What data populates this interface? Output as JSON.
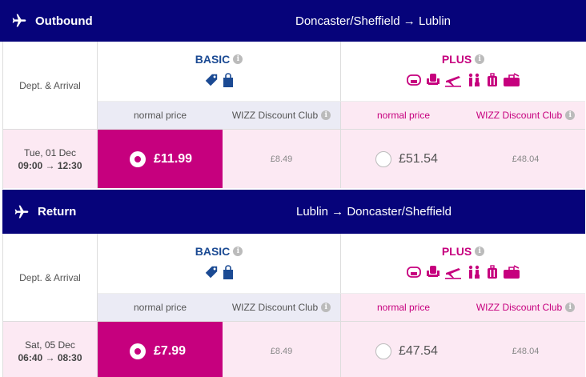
{
  "colors": {
    "navy": "#06037a",
    "basic": "#1b4a93",
    "plus": "#c6007e",
    "pink_bg": "#fce9f3",
    "lilac_bg": "#ebebf5"
  },
  "labels": {
    "dept_arrival": "Dept. & Arrival",
    "basic": "BASIC",
    "plus": "PLUS",
    "normal_price": "normal price",
    "discount_club": "WIZZ Discount Club",
    "info": "i"
  },
  "outbound": {
    "title": "Outbound",
    "route": "Doncaster/Sheffield → Lublin",
    "date": "Tue, 01 Dec",
    "times": "09:00 → 12:30",
    "basic_price": "£11.99",
    "basic_club_price": "£8.49",
    "plus_price": "£51.54",
    "plus_club_price": "£48.04",
    "selected": "basic_normal"
  },
  "return": {
    "title": "Return",
    "route": "Lublin → Doncaster/Sheffield",
    "date": "Sat, 05 Dec",
    "times": "06:40 → 08:30",
    "basic_price": "£7.99",
    "basic_club_price": "£8.49",
    "plus_price": "£47.54",
    "plus_club_price": "£48.04",
    "selected": "basic_normal"
  },
  "icons": {
    "basic": [
      "tag-icon",
      "small-bag-icon"
    ],
    "plus": [
      "seat-icon",
      "seat-selection-icon",
      "priority-boarding-icon",
      "checkin-icon",
      "cabin-bag-icon",
      "checked-bag-icon"
    ]
  }
}
